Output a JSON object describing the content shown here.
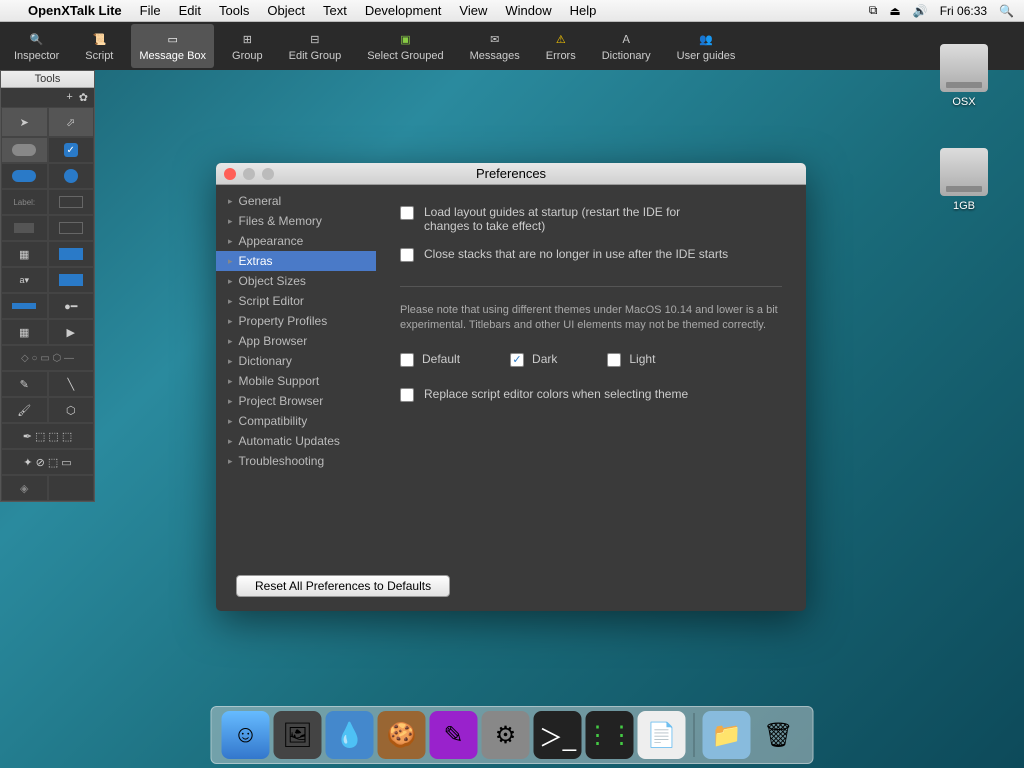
{
  "menubar": {
    "app": "OpenXTalk Lite",
    "items": [
      "File",
      "Edit",
      "Tools",
      "Object",
      "Text",
      "Development",
      "View",
      "Window",
      "Help"
    ],
    "clock": "Fri 06:33"
  },
  "toolbar": {
    "items": [
      {
        "label": "Inspector",
        "icon": "inspector"
      },
      {
        "label": "Script",
        "icon": "script"
      },
      {
        "label": "Message Box",
        "icon": "messagebox",
        "active": true
      },
      {
        "label": "Group",
        "icon": "group"
      },
      {
        "label": "Edit Group",
        "icon": "editgroup"
      },
      {
        "label": "Select Grouped",
        "icon": "selectgrouped"
      },
      {
        "label": "Messages",
        "icon": "messages"
      },
      {
        "label": "Errors",
        "icon": "errors"
      },
      {
        "label": "Dictionary",
        "icon": "dictionary"
      },
      {
        "label": "User guides",
        "icon": "userguides"
      }
    ]
  },
  "tools_palette": {
    "title": "Tools"
  },
  "desktop": {
    "icons": [
      {
        "label": "OSX"
      },
      {
        "label": "1GB"
      }
    ]
  },
  "prefs": {
    "title": "Preferences",
    "sidebar": [
      "General",
      "Files & Memory",
      "Appearance",
      "Extras",
      "Object Sizes",
      "Script Editor",
      "Property Profiles",
      "App Browser",
      "Dictionary",
      "Mobile Support",
      "Project Browser",
      "Compatibility",
      "Automatic Updates",
      "Troubleshooting"
    ],
    "selected": "Extras",
    "opt_load_guides": "Load layout guides at startup (restart the IDE for changes to take effect)",
    "opt_close_stacks": "Close stacks that are no longer in use after the IDE starts",
    "theme_note": "Please note that using different themes under MacOS 10.14 and lower is a bit experimental. Titlebars and other UI elements may not be themed correctly.",
    "theme_default": "Default",
    "theme_dark": "Dark",
    "theme_light": "Light",
    "opt_replace_colors": "Replace script editor colors when selecting theme",
    "reset": "Reset All Preferences to Defaults"
  },
  "dock": {
    "items": [
      "finder",
      "photos",
      "classic",
      "cookies",
      "oxt",
      "sysprefs",
      "terminal",
      "activity",
      "textedit"
    ],
    "right": [
      "downloads",
      "trash"
    ]
  }
}
